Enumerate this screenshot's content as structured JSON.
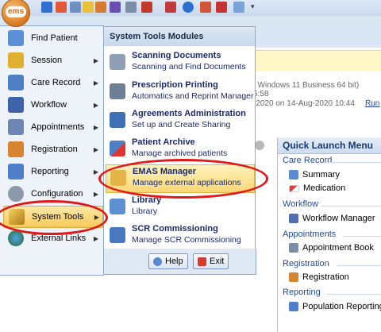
{
  "app": {
    "logo_text": "ems"
  },
  "toolbar_icons": [
    "back-icon",
    "home-icon",
    "search-icon",
    "edit-icon",
    "users-icon",
    "reports-icon",
    "settings-icon",
    "calendar-icon",
    "info-icon",
    "edit2-icon",
    "check-icon",
    "chat-icon"
  ],
  "background": {
    "info_line1": "t Windows 11 Business 64 bit)",
    "info_line2": "6:58",
    "info_line3": "-2020 on 14-Aug-2020 10:44",
    "run_link": "Run"
  },
  "menu": {
    "items": [
      {
        "label": "Find Patient",
        "icon": "find-patient-icon",
        "has_arrow": false
      },
      {
        "label": "Session",
        "icon": "key-icon",
        "has_arrow": true
      },
      {
        "label": "Care Record",
        "icon": "care-record-icon",
        "has_arrow": true
      },
      {
        "label": "Workflow",
        "icon": "workflow-icon",
        "has_arrow": true
      },
      {
        "label": "Appointments",
        "icon": "appointments-icon",
        "has_arrow": true
      },
      {
        "label": "Registration",
        "icon": "registration-icon",
        "has_arrow": true
      },
      {
        "label": "Reporting",
        "icon": "reporting-icon",
        "has_arrow": true
      },
      {
        "label": "Configuration",
        "icon": "configuration-icon",
        "has_arrow": true
      },
      {
        "label": "System Tools",
        "icon": "pencil-icon",
        "has_arrow": true,
        "selected": true
      },
      {
        "label": "External Links",
        "icon": "globe-icon",
        "has_arrow": true
      }
    ]
  },
  "submenu": {
    "title": "System Tools Modules",
    "items": [
      {
        "title": "Scanning Documents",
        "desc": "Scanning and Find Documents",
        "icon": "scanner-icon"
      },
      {
        "title": "Prescription Printing",
        "desc": "Automatics and Reprint Manager",
        "icon": "printer-icon"
      },
      {
        "title": "Agreements Administration",
        "desc": "Set up and Create Sharing",
        "icon": "book-icon"
      },
      {
        "title": "Patient Archive",
        "desc": "Manage archived patients",
        "icon": "patient-archive-icon"
      },
      {
        "title": "EMAS Manager",
        "desc": "Manage external applications",
        "icon": "lock-icon",
        "selected": true
      },
      {
        "title": "Library",
        "desc": "Library",
        "icon": "library-icon"
      },
      {
        "title": "SCR Commissioning",
        "desc": "Manage SCR Commissioning",
        "icon": "scr-icon"
      }
    ]
  },
  "buttons": {
    "help": "Help",
    "exit": "Exit"
  },
  "quick_launch": {
    "title": "Quick Launch Menu",
    "sections": [
      {
        "name": "Care Record",
        "items": [
          {
            "label": "Summary",
            "icon": "summary-icon"
          },
          {
            "label": "Medication",
            "icon": "medication-icon"
          }
        ]
      },
      {
        "name": "Workflow",
        "items": [
          {
            "label": "Workflow Manager",
            "icon": "workflow-manager-icon"
          }
        ]
      },
      {
        "name": "Appointments",
        "items": [
          {
            "label": "Appointment Book",
            "icon": "appointment-book-icon"
          }
        ]
      },
      {
        "name": "Registration",
        "items": [
          {
            "label": "Registration",
            "icon": "registration-icon"
          }
        ]
      },
      {
        "name": "Reporting",
        "items": [
          {
            "label": "Population Reporting",
            "icon": "population-reporting-icon"
          }
        ]
      }
    ]
  },
  "colors": {
    "highlight": "#f6c95a",
    "annotation": "#e01818",
    "link": "#1e4b99"
  }
}
